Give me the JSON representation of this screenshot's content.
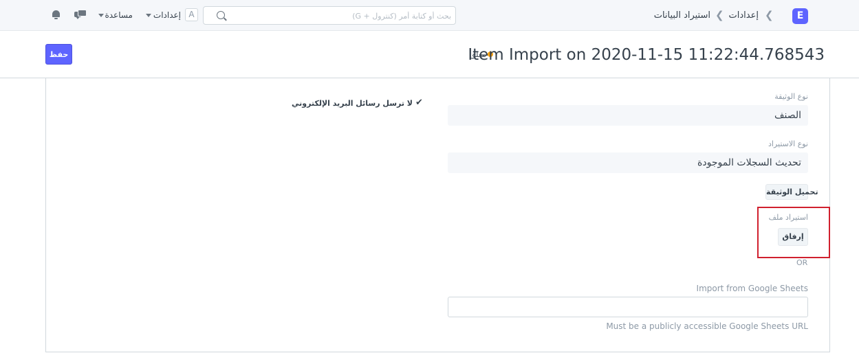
{
  "navbar": {
    "brand_letter": "E",
    "breadcrumbs": [
      "إعدادات",
      "استيراد البيانات"
    ],
    "search_placeholder": "بحث أو كتابة أمر (كنترول + G)",
    "avatar_letter": "A",
    "settings_label": "إعدادات",
    "help_label": "مساعدة"
  },
  "page": {
    "title": "Item Import on 2020-11-15 11:22:44.768543",
    "status": "معلق",
    "save_label": "حفظ"
  },
  "form": {
    "doctype_label": "نوع الوثيقة",
    "doctype_value": "الصنف",
    "import_type_label": "نوع الاستيراد",
    "import_type_value": "تحديث السجلات الموجودة",
    "download_template_label": "تحميل الوثيقة",
    "import_file_label": "استيراد ملف",
    "attach_label": "إرفاق",
    "or_label": "OR",
    "google_sheets_label": "Import from Google Sheets",
    "google_sheets_value": "",
    "google_sheets_help": "Must be a publicly accessible Google Sheets URL",
    "no_email_label": "لا ترسل رسائل البريد الإلكتروني",
    "no_email_checked": true
  },
  "colors": {
    "primary": "#5e64ff",
    "status_dot": "#ffa00a",
    "highlight": "#d0202e"
  }
}
